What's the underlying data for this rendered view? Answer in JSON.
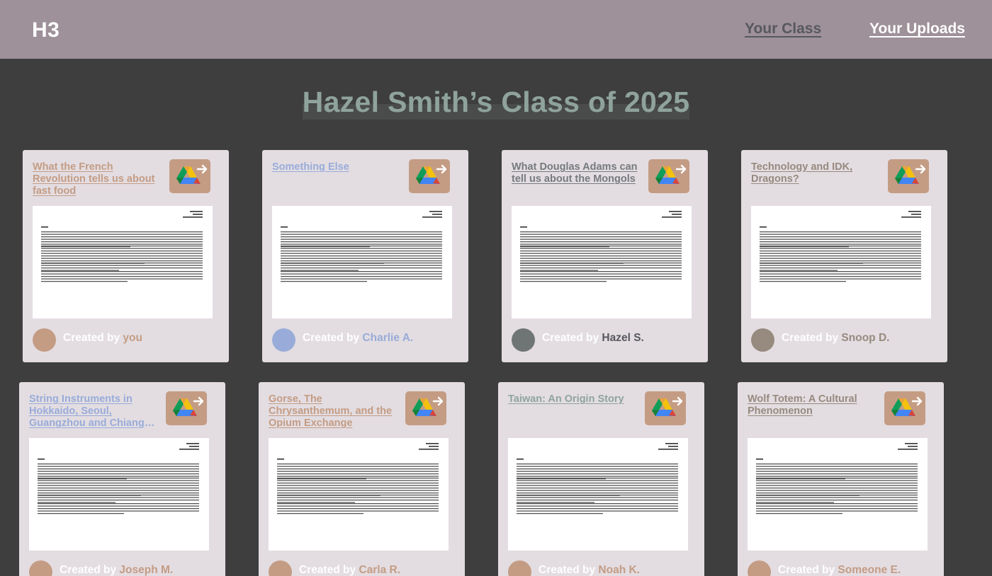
{
  "header": {
    "logo": "H3",
    "nav": {
      "your_class": "Your Class",
      "your_uploads": "Your Uploads"
    }
  },
  "page_title": "Hazel Smith’s Class of 2025",
  "credit_prefix": "Created by ",
  "cards": [
    {
      "title": "What the French Revolution tells us about fast food",
      "author": "you",
      "title_color": "#c49c84",
      "author_color": "#c49c84",
      "avatar_color": "#c49c84"
    },
    {
      "title": "Something Else",
      "author": "Charlie A.",
      "title_color": "#99acd9",
      "author_color": "#99acd9",
      "avatar_color": "#99acd9"
    },
    {
      "title": "What Douglas Adams can tell us about the Mongols",
      "author": "Hazel S.",
      "title_color": "#767b7d",
      "author_color": "#57585f",
      "avatar_color": "#6f7575"
    },
    {
      "title": "Technology and IDK, Dragons?",
      "author": "Snoop D.",
      "title_color": "#978a7e",
      "author_color": "#978a7e",
      "avatar_color": "#978a7e"
    },
    {
      "title": "String Instruments in Hokkaido, Seoul, Guangzhou and Chiang Mai",
      "author": "Joseph M.",
      "title_color": "#99acd9",
      "author_color": "#c49c84",
      "avatar_color": "#c49c84"
    },
    {
      "title": "Gorse, The Chrysanthemum, and the Opium Exchange",
      "author": "Carla R.",
      "title_color": "#c49c84",
      "author_color": "#c49c84",
      "avatar_color": "#c49c84"
    },
    {
      "title": "Taiwan: An Origin Story",
      "author": "Noah K.",
      "title_color": "#8fa39c",
      "author_color": "#c49c84",
      "avatar_color": "#c49c84"
    },
    {
      "title": "Wolf Totem: A Cultural Phenomenon",
      "author": "Someone E.",
      "title_color": "#978a7e",
      "author_color": "#c49c84",
      "avatar_color": "#c49c84"
    }
  ],
  "icons": {
    "drive_button": "google-drive-export-icon",
    "document": "document-preview"
  },
  "colors": {
    "background": "#3e3e3e",
    "topbar": "#9e9199",
    "card": "#e3dde2",
    "drive_button": "#c49c84",
    "title": "#8fa39c"
  }
}
